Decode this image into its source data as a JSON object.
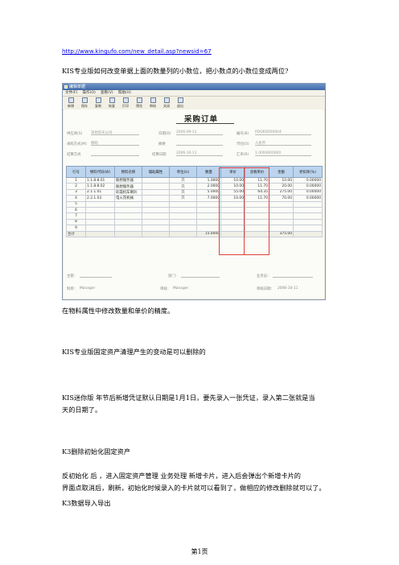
{
  "link": "http://www.kingufo.com/new_detail.asp?newsid=67",
  "paragraphs": {
    "q1": "KIS专业版如何改变单据上面的数量列的小数位，把小数点的小数位变成两位?",
    "p1": "在物料属性中修改数量和单价的精度。",
    "p2": "KIS专业版固定资产清理产生的变动是可以删除的",
    "p3a": "KIS迷你版    年节后新增凭证默认日期是1月1日，要先录入一张凭证，录入第二张就是当",
    "p3b": "天的日期了。",
    "p4": "K3删除初始化固定资产",
    "p5a": "反初始化  后 ，进入固定资产管理       业务处理     新增卡片，进入后会弹出个新增卡片的",
    "p5b": "界面点取消后，刷新，初始化时候录入的卡片就可以看到了，做相应的修改删除就可以了。",
    "p6": "K3数据导入导出"
  },
  "footer": {
    "page": "第1页"
  },
  "screenshot": {
    "window_title": "编辑单据",
    "menu": [
      "文件(F)",
      "操作(O)",
      "查看(V)",
      "帮助(H)"
    ],
    "toolbar": [
      "新增",
      "保存",
      "复制",
      "恢复",
      "打印",
      "预览",
      "审核",
      "关闭",
      "退出"
    ],
    "form_title": "采购订单",
    "fields": {
      "supplier_label": "供应商(S)",
      "supplier_value": "深圳华天公司",
      "date_label": "日期(D)",
      "date_value": "2006-09-11",
      "number_label": "编号(B)",
      "number_value": "POORD000004",
      "purchase_label": "采购方式(M)",
      "purchase_value": "赊购",
      "summary_label": "摘要",
      "currency_label": "币别(O)",
      "currency_value": "人民币",
      "settle_label": "结算方式",
      "settle_date_label": "结算日期",
      "settle_date_value": "2006-10-11",
      "rate_label": "汇率(R)",
      "rate_value": "1.0000000000"
    },
    "columns": [
      "行号",
      "物料代码(W)",
      "物料名称",
      "辅助属性",
      "单位(U)",
      "数量",
      "单价",
      "含税单价",
      "金额",
      "折扣率(%)"
    ],
    "rows": [
      [
        "1",
        "1.1.8.8.01",
        "联想服务器",
        "",
        "只",
        "1.0000",
        "10.00",
        "11.70",
        "10.00",
        "0.00000"
      ],
      [
        "2",
        "1.1.8.8.02",
        "联想服务器",
        "",
        "只",
        "2.0000",
        "10.00",
        "11.70",
        "20.00",
        "0.00000"
      ],
      [
        "3",
        "2.1.1.01",
        "彩霞机车喇叭",
        "",
        "只",
        "5.0000",
        "55.00",
        "64.35",
        "275.00",
        "0.00000"
      ],
      [
        "4",
        "2.2.1.03",
        "电火花机械",
        "",
        "只",
        "7.0000",
        "10.00",
        "11.70",
        "70.00",
        "0.00000"
      ],
      [
        "5",
        "",
        "",
        "",
        "",
        "",
        "",
        "",
        "",
        ""
      ],
      [
        "6",
        "",
        "",
        "",
        "",
        "",
        "",
        "",
        "",
        ""
      ],
      [
        "7",
        "",
        "",
        "",
        "",
        "",
        "",
        "",
        "",
        ""
      ],
      [
        "8",
        "",
        "",
        "",
        "",
        "",
        "",
        "",
        "",
        ""
      ],
      [
        "9",
        "",
        "",
        "",
        "",
        "",
        "",
        "",
        "",
        ""
      ]
    ],
    "sum_label": "合计",
    "sum_qty": "15.0000",
    "sum_amount": "375.00",
    "bottom": {
      "manager_label": "主管：",
      "dept_label": "部门：",
      "business_label": "业务员：",
      "maker_label": "制单：",
      "maker_value": "Manager",
      "reviewer_label": "审核：",
      "reviewer_value": "Manager",
      "review_date_label": "审核日期：",
      "review_date_value": "2006-10-11"
    }
  }
}
